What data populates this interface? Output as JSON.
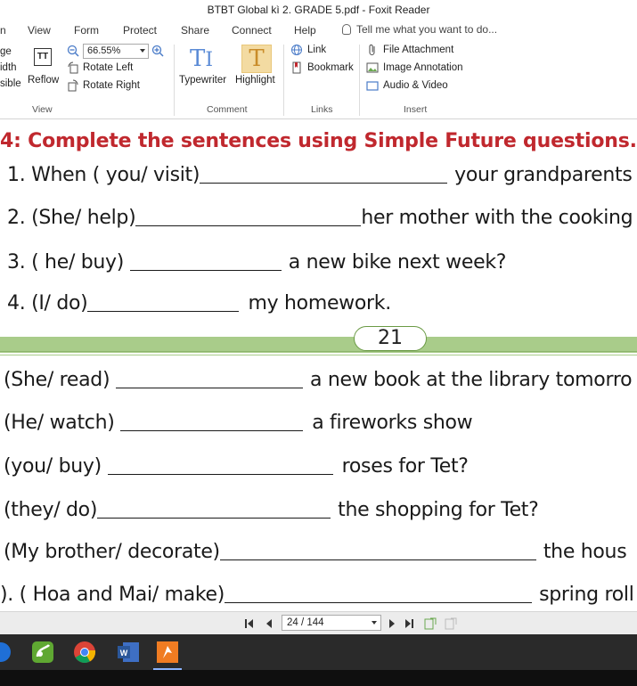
{
  "window": {
    "title": "BTBT Global kì 2. GRADE 5.pdf - Foxit Reader"
  },
  "menu": {
    "items": [
      "n",
      "View",
      "Form",
      "Protect",
      "Share",
      "Connect",
      "Help"
    ],
    "tell_me": "Tell me what you want to do..."
  },
  "ribbon": {
    "view": {
      "page_label": "ge",
      "width_label": "idth",
      "visible_label": "sible",
      "reflow": "Reflow",
      "zoom": "66.55%",
      "rotate_left": "Rotate Left",
      "rotate_right": "Rotate Right",
      "group": "View"
    },
    "comment": {
      "typewriter": "Typewriter",
      "highlight": "Highlight",
      "group": "Comment"
    },
    "links": {
      "link": "Link",
      "bookmark": "Bookmark",
      "group": "Links"
    },
    "insert": {
      "file_attachment": "File Attachment",
      "image_annotation": "Image Annotation",
      "audio_video": "Audio & Video",
      "group": "Insert"
    }
  },
  "document": {
    "heading": "4: Complete the sentences using Simple Future questions.",
    "top_questions": [
      {
        "prompt": "1. When ( you/ visit)",
        "rest": "your grandparents"
      },
      {
        "prompt": "2. (She/ help)",
        "rest": "her mother with the cooking"
      },
      {
        "prompt": "3. ( he/ buy) ",
        "rest": "a new bike next week?"
      },
      {
        "prompt": "4. (I/ do)",
        "rest": "my homework."
      }
    ],
    "page_number": "21",
    "bottom_questions": [
      {
        "prompt": "(She/ read) ",
        "rest": "a new book at the library tomorro"
      },
      {
        "prompt": "(He/ watch) ",
        "rest": "a fireworks show"
      },
      {
        "prompt": "(you/ buy) ",
        "rest": "roses for Tet?"
      },
      {
        "prompt": "(they/ do)",
        "rest": "the shopping for Tet?"
      },
      {
        "prompt": "(My brother/ decorate)",
        "rest": "the hous"
      },
      {
        "prompt": "). ( Hoa and Mai/ make)",
        "rest": "spring roll"
      }
    ]
  },
  "navigation": {
    "page_field": "24 / 144"
  },
  "taskbar": {
    "apps": [
      "Greenshot",
      "Chrome",
      "Word",
      "Foxit"
    ]
  },
  "colors": {
    "heading": "#c0282e",
    "band": "#a9cc8a",
    "highlight": "#f3dba2"
  }
}
